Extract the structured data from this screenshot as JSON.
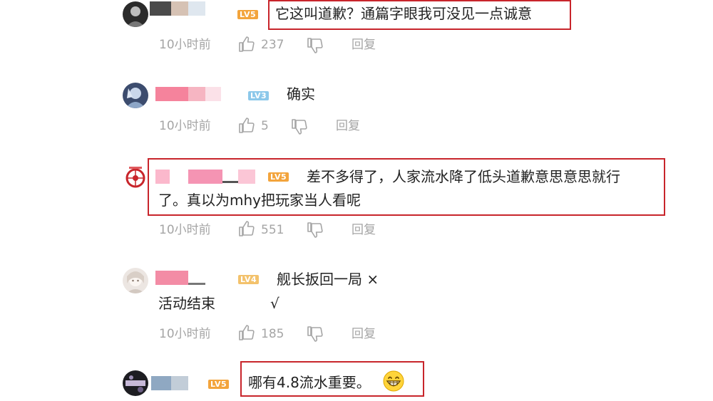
{
  "colors": {
    "lv5": "#f3a43c",
    "lv3": "#8cc8ea",
    "lv4": "#f3c26c",
    "meta": "#a5a5a5",
    "highlight_box": "#c8252b"
  },
  "comments": [
    {
      "level": "LV5",
      "text_lines": [
        "它这叫道歉？通篇字眼我可没见一点诚意"
      ],
      "time": "10小时前",
      "likes": "237",
      "reply": "回复"
    },
    {
      "level": "LV3",
      "text_lines": [
        "确实"
      ],
      "time": "10小时前",
      "likes": "5",
      "reply": "回复"
    },
    {
      "level": "LV5",
      "text_lines": [
        "差不多得了，人家流水降了低头道歉意思意思就行",
        "了。真以为mhy把玩家当人看呢"
      ],
      "time": "10小时前",
      "likes": "551",
      "reply": "回复"
    },
    {
      "level": "LV4",
      "text_lines": [
        "舰长扳回一局 ×",
        "活动结束",
        "√"
      ],
      "time": "10小时前",
      "likes": "185",
      "reply": "回复"
    },
    {
      "level": "LV5",
      "text_lines": [
        "哪有4.8流水重要。"
      ],
      "emoji": "grin-emoji"
    }
  ]
}
